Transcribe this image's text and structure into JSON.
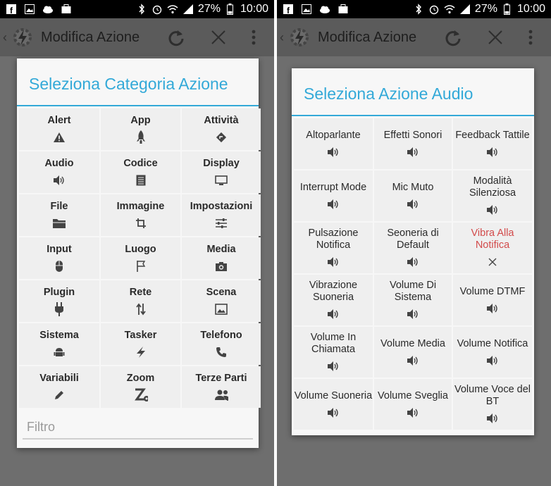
{
  "status": {
    "battery": "27%",
    "time": "10:00"
  },
  "actionbar": {
    "title": "Modifica Azione"
  },
  "categories_dialog": {
    "title": "Seleziona Categoria Azione",
    "filter_placeholder": "Filtro",
    "items": [
      {
        "label": "Alert",
        "icon": "warning-icon"
      },
      {
        "label": "App",
        "icon": "rocket-icon"
      },
      {
        "label": "Attività",
        "icon": "direction-sign-icon"
      },
      {
        "label": "Audio",
        "icon": "speaker-icon"
      },
      {
        "label": "Codice",
        "icon": "document-icon"
      },
      {
        "label": "Display",
        "icon": "monitor-icon"
      },
      {
        "label": "File",
        "icon": "folder-icon"
      },
      {
        "label": "Immagine",
        "icon": "crop-icon"
      },
      {
        "label": "Impostazioni",
        "icon": "sliders-icon"
      },
      {
        "label": "Input",
        "icon": "mouse-icon"
      },
      {
        "label": "Luogo",
        "icon": "flag-icon"
      },
      {
        "label": "Media",
        "icon": "camera-icon"
      },
      {
        "label": "Plugin",
        "icon": "plug-icon"
      },
      {
        "label": "Rete",
        "icon": "up-down-arrows-icon"
      },
      {
        "label": "Scena",
        "icon": "picture-icon"
      },
      {
        "label": "Sistema",
        "icon": "android-icon"
      },
      {
        "label": "Tasker",
        "icon": "lightning-icon"
      },
      {
        "label": "Telefono",
        "icon": "phone-icon"
      },
      {
        "label": "Variabili",
        "icon": "pencil-icon"
      },
      {
        "label": "Zoom",
        "icon": "zoom-z-icon"
      },
      {
        "label": "Terze Parti",
        "icon": "people-icon"
      }
    ]
  },
  "audio_dialog": {
    "title": "Seleziona Azione Audio",
    "items": [
      {
        "label": "Altoparlante",
        "icon": "speaker-icon"
      },
      {
        "label": "Effetti Sonori",
        "icon": "speaker-icon"
      },
      {
        "label": "Feedback Tattile",
        "icon": "speaker-icon"
      },
      {
        "label": "Interrupt Mode",
        "icon": "speaker-icon"
      },
      {
        "label": "Mic Muto",
        "icon": "speaker-icon"
      },
      {
        "label": "Modalità Silenziosa",
        "icon": "speaker-icon"
      },
      {
        "label": "Pulsazione Notifica",
        "icon": "speaker-icon"
      },
      {
        "label": "Seoneria di Default",
        "icon": "speaker-icon"
      },
      {
        "label": "Vibra Alla Notifica",
        "icon": "close-x-icon",
        "highlight": "#d24a4a"
      },
      {
        "label": "Vibrazione Suoneria",
        "icon": "speaker-icon"
      },
      {
        "label": "Volume Di Sistema",
        "icon": "speaker-icon"
      },
      {
        "label": "Volume DTMF",
        "icon": "speaker-icon"
      },
      {
        "label": "Volume In Chiamata",
        "icon": "speaker-icon"
      },
      {
        "label": "Volume Media",
        "icon": "speaker-icon"
      },
      {
        "label": "Volume Notifica",
        "icon": "speaker-icon"
      },
      {
        "label": "Volume Suoneria",
        "icon": "speaker-icon"
      },
      {
        "label": "Volume Sveglia",
        "icon": "speaker-icon"
      },
      {
        "label": "Volume Voce del BT",
        "icon": "speaker-icon"
      }
    ]
  },
  "colors": {
    "accent": "#33a9d8",
    "error_text": "#d24a4a",
    "overlay": "#6e6e6e"
  }
}
